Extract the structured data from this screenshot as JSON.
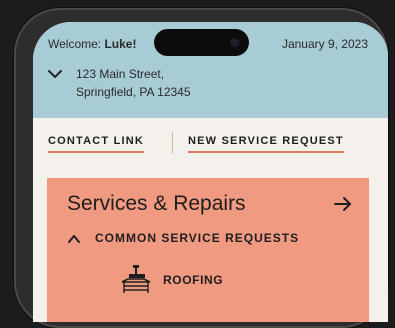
{
  "header": {
    "welcome_prefix": "Welcome: ",
    "user_name": "Luke!",
    "date": "January 9, 2023",
    "address_line1": "123 Main Street,",
    "address_line2": "Springfield, PA 12345",
    "toggle_icon": "chevron-down-icon"
  },
  "links": {
    "contact": "CONTACT LINK",
    "new_request": "NEW SERVICE REQUEST"
  },
  "services": {
    "title": "Services & Repairs",
    "arrow_icon": "arrow-right-icon",
    "section_toggle_icon": "chevron-up-icon",
    "section_label": "COMMON SERVICE REQUESTS",
    "items": [
      {
        "label": "ROOFING",
        "icon": "roofing-icon"
      }
    ]
  },
  "colors": {
    "header_bg": "#a8ccd6",
    "card_bg": "#f19a82",
    "accent_underline": "#e07a5f",
    "page_bg": "#f4f1ec"
  }
}
